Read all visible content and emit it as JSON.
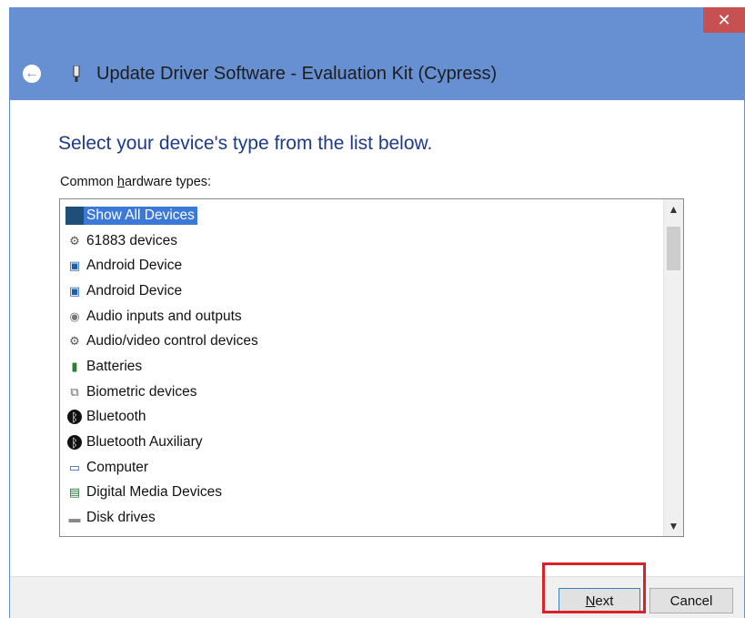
{
  "window": {
    "title": "Update Driver Software - Evaluation Kit (Cypress)",
    "close_glyph": "✕",
    "back_glyph": "←"
  },
  "main": {
    "heading": "Select your device's type from the list below.",
    "list_label_prefix": "Common ",
    "list_label_underlined": "h",
    "list_label_suffix": "ardware types:"
  },
  "list": {
    "items": [
      {
        "label": "Show All Devices",
        "icon": "all-devices-icon",
        "selected": true
      },
      {
        "label": "61883 devices",
        "icon": "plug-icon"
      },
      {
        "label": "Android Device",
        "icon": "android-device-icon"
      },
      {
        "label": "Android Device",
        "icon": "android-device-icon"
      },
      {
        "label": "Audio inputs and outputs",
        "icon": "speaker-icon"
      },
      {
        "label": "Audio/video control devices",
        "icon": "plug-icon"
      },
      {
        "label": "Batteries",
        "icon": "battery-icon"
      },
      {
        "label": "Biometric devices",
        "icon": "biometric-icon"
      },
      {
        "label": "Bluetooth",
        "icon": "bluetooth-icon"
      },
      {
        "label": "Bluetooth Auxiliary",
        "icon": "bluetooth-icon"
      },
      {
        "label": "Computer",
        "icon": "computer-icon"
      },
      {
        "label": "Digital Media Devices",
        "icon": "media-device-icon"
      },
      {
        "label": "Disk drives",
        "icon": "disk-drive-icon"
      }
    ]
  },
  "buttons": {
    "next": "Next",
    "next_underlined": "N",
    "next_rest": "ext",
    "cancel": "Cancel"
  },
  "colors": {
    "title_bar": "#6790d3",
    "close": "#c75050",
    "heading": "#1e3a8a",
    "selection": "#3c78d8",
    "highlight": "#d8232a"
  }
}
